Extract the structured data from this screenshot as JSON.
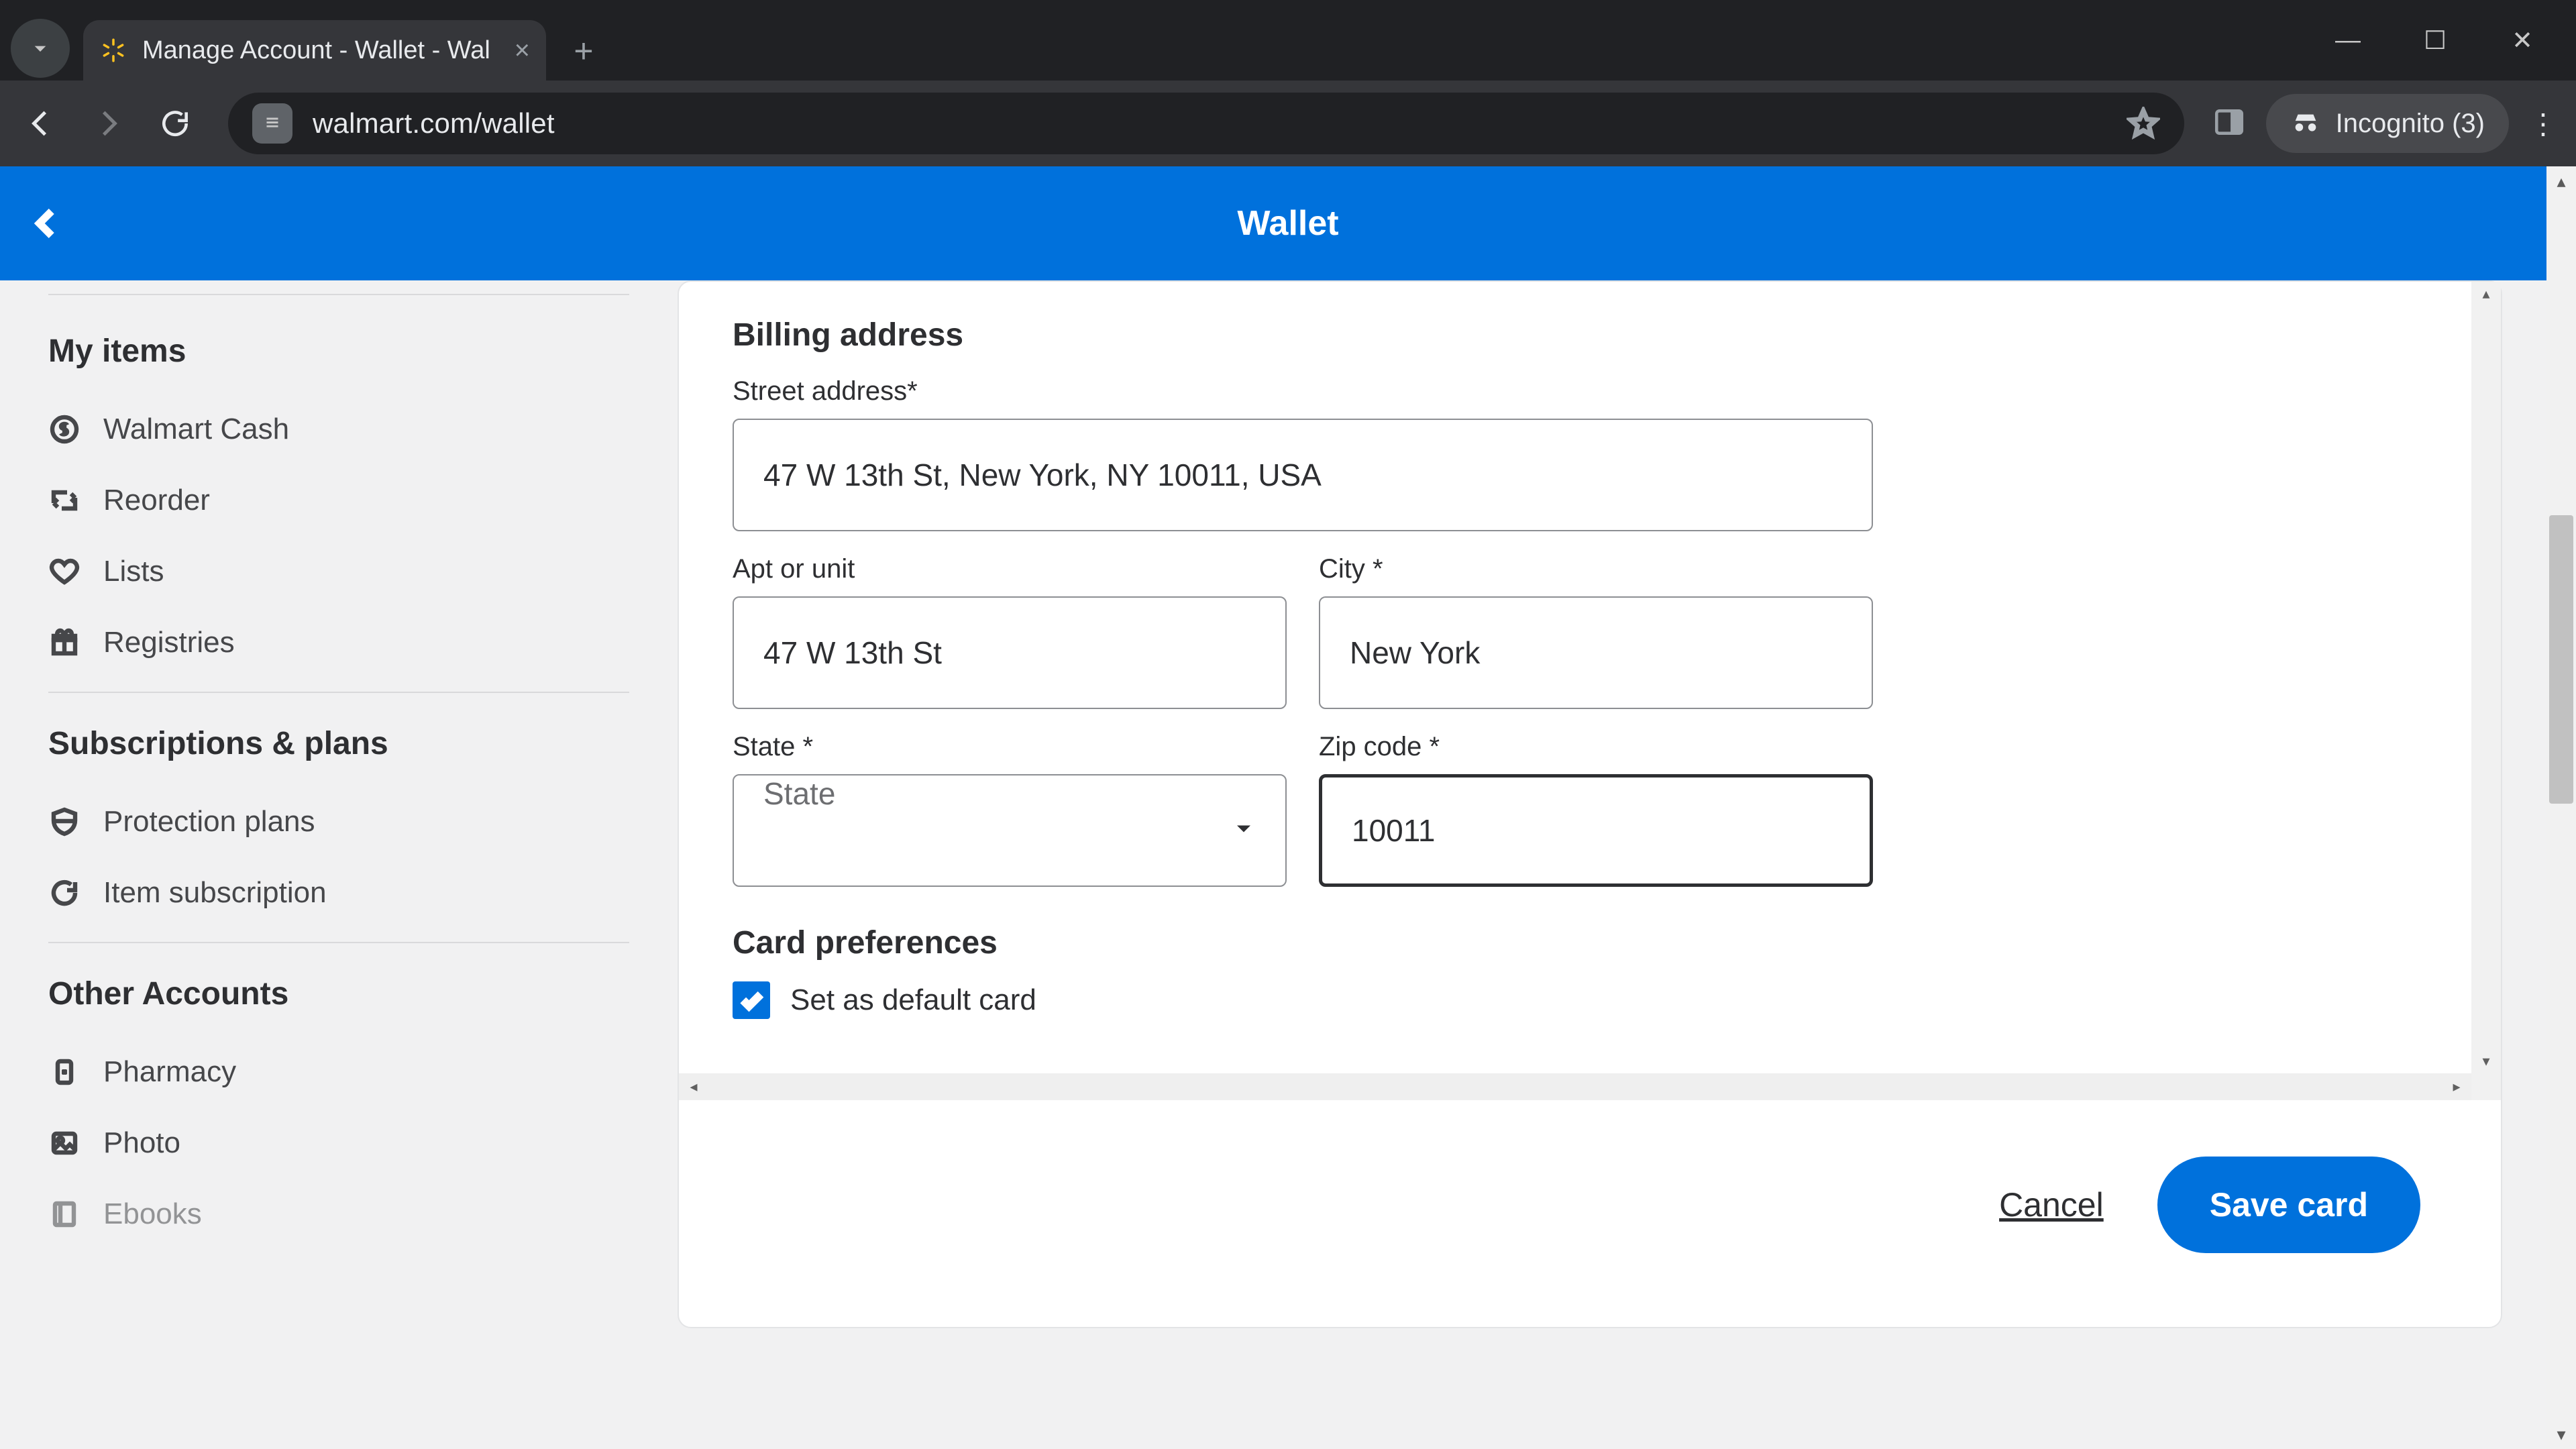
{
  "browser": {
    "tab_title": "Manage Account - Wallet - Wal",
    "url": "walmart.com/wallet",
    "incognito_label": "Incognito (3)"
  },
  "header": {
    "title": "Wallet"
  },
  "sidebar": {
    "sections": [
      {
        "title": "My items",
        "items": [
          {
            "label": "Walmart Cash"
          },
          {
            "label": "Reorder"
          },
          {
            "label": "Lists"
          },
          {
            "label": "Registries"
          }
        ]
      },
      {
        "title": "Subscriptions & plans",
        "items": [
          {
            "label": "Protection plans"
          },
          {
            "label": "Item subscription"
          }
        ]
      },
      {
        "title": "Other Accounts",
        "items": [
          {
            "label": "Pharmacy"
          },
          {
            "label": "Photo"
          },
          {
            "label": "Ebooks"
          }
        ]
      }
    ]
  },
  "form": {
    "billing_title": "Billing address",
    "street_label": "Street address*",
    "street_value": "47 W 13th St, New York, NY 10011, USA",
    "apt_label": "Apt or unit",
    "apt_value": "47 W 13th St",
    "city_label": "City *",
    "city_value": "New York",
    "state_label": "State *",
    "state_placeholder": "State",
    "zip_label": "Zip code *",
    "zip_value": "10011",
    "prefs_title": "Card preferences",
    "default_label": "Set as default card"
  },
  "actions": {
    "cancel": "Cancel",
    "save": "Save card"
  }
}
